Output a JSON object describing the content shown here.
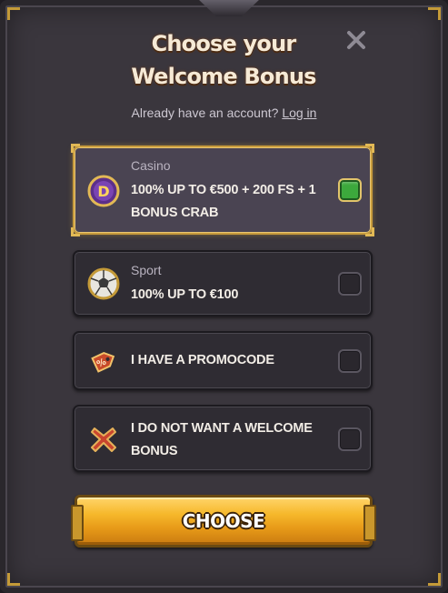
{
  "modal": {
    "title": "Choose your Welcome Bonus",
    "login_prompt": "Already have an account?",
    "login_link": "Log in",
    "close_icon": "close-icon"
  },
  "options": [
    {
      "category": "Casino",
      "text": "100% UP TO €500 + 200 FS + 1 BONUS CRAB",
      "icon": "casino-coin-icon",
      "selected": true
    },
    {
      "category": "Sport",
      "text": "100% UP TO €100",
      "icon": "soccer-ball-icon",
      "selected": false
    },
    {
      "category": "",
      "text": "I HAVE A PROMOCODE",
      "icon": "promo-tag-icon",
      "selected": false
    },
    {
      "category": "",
      "text": "I DO NOT WANT A WELCOME BONUS",
      "icon": "cross-icon",
      "selected": false
    }
  ],
  "choose_button": {
    "label": "CHOOSE"
  },
  "colors": {
    "accent_gold": "#c79b3c",
    "checkbox_selected": "#3ca93c",
    "panel": "#3a363d"
  }
}
